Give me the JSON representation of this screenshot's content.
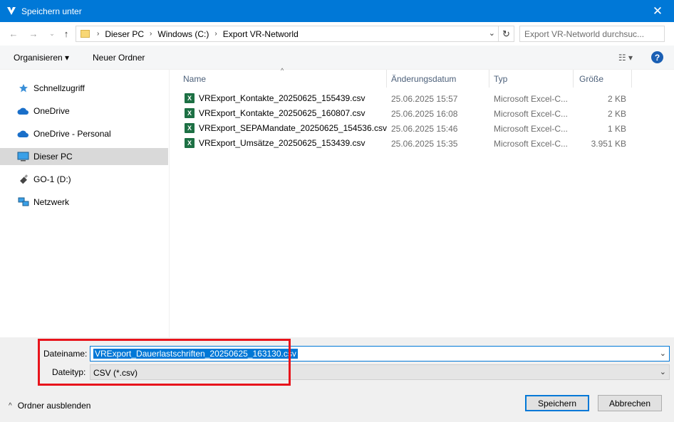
{
  "window": {
    "title": "Speichern unter",
    "close_symbol": "✕"
  },
  "nav": {
    "breadcrumbs": [
      "Dieser PC",
      "Windows (C:)",
      "Export VR-Networld"
    ],
    "search_placeholder": "Export VR-Networld durchsuc..."
  },
  "toolbar": {
    "organize": "Organisieren ▾",
    "new_folder": "Neuer Ordner",
    "help": "?"
  },
  "sidebar": {
    "items": [
      {
        "label": "Schnellzugriff",
        "icon": "star-icon"
      },
      {
        "label": "OneDrive",
        "icon": "cloud-icon"
      },
      {
        "label": "OneDrive - Personal",
        "icon": "cloud-icon"
      },
      {
        "label": "Dieser PC",
        "icon": "computer-icon",
        "selected": true
      },
      {
        "label": "GO-1 (D:)",
        "icon": "usb-drive-icon"
      },
      {
        "label": "Netzwerk",
        "icon": "network-icon"
      }
    ]
  },
  "files": {
    "columns": [
      "Name",
      "Änderungsdatum",
      "Typ",
      "Größe"
    ],
    "rows": [
      {
        "name": "VRExport_Kontakte_20250625_155439.csv",
        "date": "25.06.2025 15:57",
        "type": "Microsoft Excel-C...",
        "size": "2 KB"
      },
      {
        "name": "VRExport_Kontakte_20250625_160807.csv",
        "date": "25.06.2025 16:08",
        "type": "Microsoft Excel-C...",
        "size": "2 KB"
      },
      {
        "name": "VRExport_SEPAMandate_20250625_154536.csv",
        "date": "25.06.2025 15:46",
        "type": "Microsoft Excel-C...",
        "size": "1 KB"
      },
      {
        "name": "VRExport_Umsätze_20250625_153439.csv",
        "date": "25.06.2025 15:35",
        "type": "Microsoft Excel-C...",
        "size": "3.951 KB"
      }
    ]
  },
  "save": {
    "filename_label": "Dateiname:",
    "filename_value": "VRExport_Dauerlastschriften_20250625_163130.csv",
    "filetype_label": "Dateityp:",
    "filetype_value": "CSV (*.csv)",
    "hide_folders": "Ordner ausblenden",
    "save_button": "Speichern",
    "cancel_button": "Abbrechen"
  },
  "colors": {
    "accent": "#0078d7",
    "highlight": "#e8141c"
  }
}
